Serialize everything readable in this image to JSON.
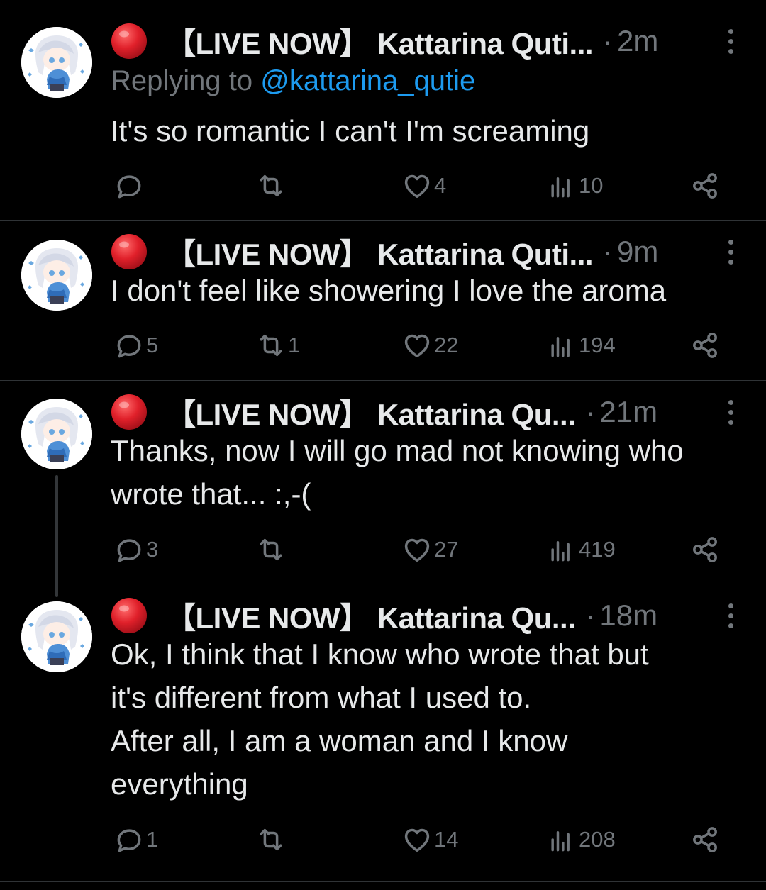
{
  "colors": {
    "background": "#000000",
    "text": "#e7e9ea",
    "secondary": "#71767b",
    "link": "#1d9bf0",
    "live_dot": "#e0202a",
    "divider": "#2f3336"
  },
  "tweets": [
    {
      "live_icon": "red-circle-icon",
      "display_name": "【LIVE NOW】 Kattarina Quti...",
      "separator": "·",
      "time": "2m",
      "replying_prefix": "Replying to ",
      "replying_handle": "@kattarina_qutie",
      "text": "It's so romantic I can't I'm screaming",
      "replies": "",
      "reposts": "",
      "likes": "4",
      "views": "10"
    },
    {
      "live_icon": "red-circle-icon",
      "display_name": "【LIVE NOW】 Kattarina Quti...",
      "separator": "·",
      "time": "9m",
      "text": "I don't feel like showering I love the aroma",
      "replies": "5",
      "reposts": "1",
      "likes": "22",
      "views": "194"
    },
    {
      "live_icon": "red-circle-icon",
      "display_name": "【LIVE NOW】 Kattarina Qu...",
      "separator": "·",
      "time": "21m",
      "text": "Thanks, now I will go mad not knowing who wrote that... :,-(",
      "replies": "3",
      "reposts": "",
      "likes": "27",
      "views": "419"
    },
    {
      "live_icon": "red-circle-icon",
      "display_name": "【LIVE NOW】 Kattarina Qu...",
      "separator": "·",
      "time": "18m",
      "text_lines": [
        "Ok, I think that I know who wrote that but",
        "it's different from what I used to.",
        "After all, I am a woman and I know",
        "everything"
      ],
      "replies": "1",
      "reposts": "",
      "likes": "14",
      "views": "208"
    }
  ]
}
